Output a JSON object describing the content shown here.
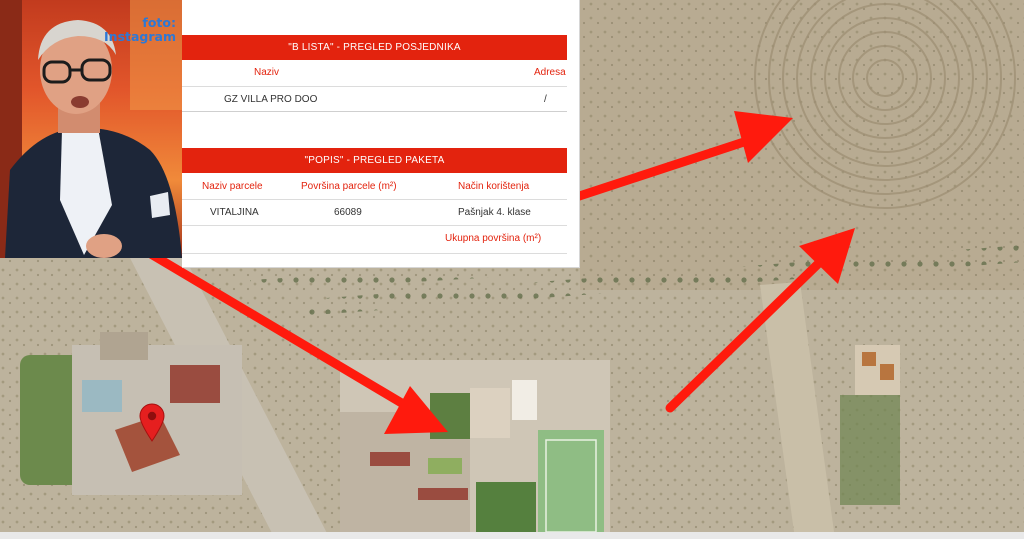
{
  "photo": {
    "credit_line1": "foto:",
    "credit_line2": "Instagram"
  },
  "owners_section": {
    "title": "\"B LISTA\" - PREGLED POSJEDNIKA",
    "columns": [
      "Naziv",
      "Adresa"
    ],
    "rows": [
      {
        "naziv": "GZ VILLA PRO DOO",
        "adresa": "/"
      }
    ]
  },
  "parcels_section": {
    "title": "\"POPIS\" - PREGLED PAKETA",
    "columns": [
      "Naziv parcele",
      "Površina parcele (m²)",
      "Način korištenja"
    ],
    "rows": [
      {
        "naziv": "VITALJINA",
        "povrsina": "66089",
        "nacin": "Pašnjak 4. klase"
      }
    ],
    "total_label": "Ukupna površina (m²)"
  },
  "map": {
    "pin_color": "#e51f1f",
    "arrow_color": "#ff1a0d",
    "arrows_count": 3,
    "pin_icon": "location-pin-icon"
  }
}
